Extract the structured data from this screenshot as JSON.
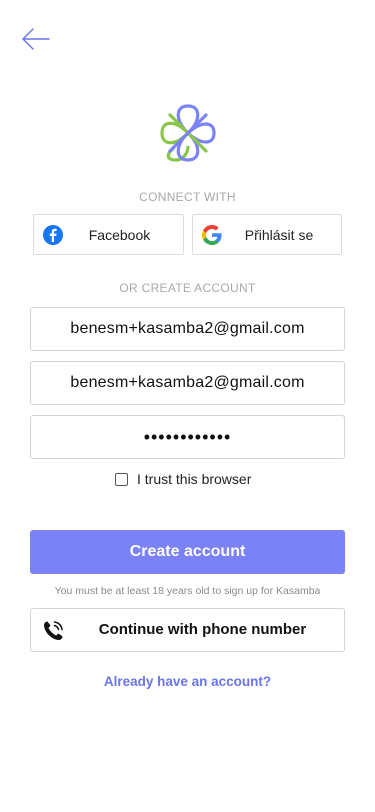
{
  "nav": {
    "back_icon": "arrow-left-icon",
    "back_color": "#6a74ee"
  },
  "brand": {
    "logo_icon": "kasamba-logo",
    "colors": [
      "#7b82f5",
      "#8ac64a"
    ]
  },
  "connect": {
    "label": "CONNECT WITH",
    "facebook": {
      "label": "Facebook",
      "icon": "facebook-icon",
      "color": "#1877f2"
    },
    "google": {
      "label": "Přihlásit se",
      "icon": "google-icon"
    }
  },
  "create": {
    "label": "OR CREATE ACCOUNT",
    "email": "benesm+kasamba2@gmail.com",
    "email_confirm": "benesm+kasamba2@gmail.com",
    "password_masked": "••••••••••••",
    "trust_label": "I trust this browser",
    "trust_checked": false,
    "submit_label": "Create account",
    "submit_color": "#7b82f5"
  },
  "age_note": "You must be at least 18 years old to sign up for Kasamba",
  "phone": {
    "label": "Continue with phone number",
    "icon": "phone-icon"
  },
  "login_link": "Already have an account?"
}
